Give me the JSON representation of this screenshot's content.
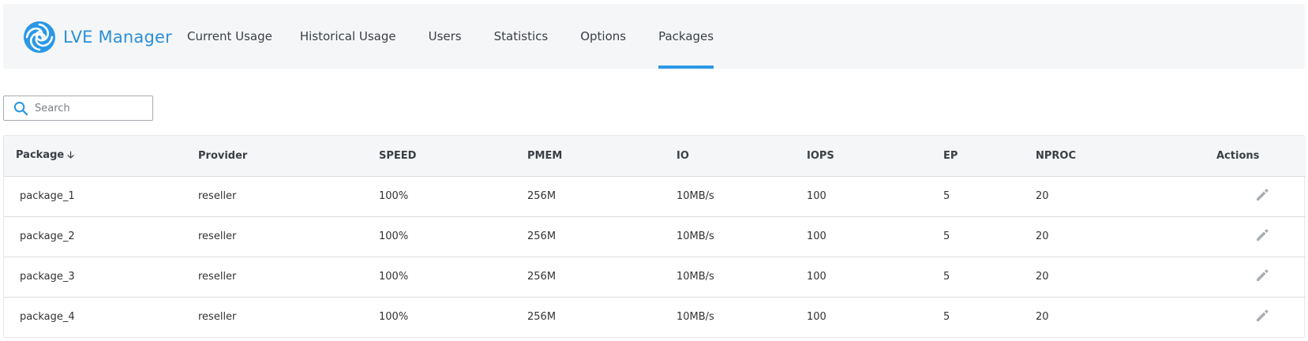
{
  "app": {
    "name": "LVE Manager",
    "accent": "#2a98e6"
  },
  "nav": [
    {
      "label": "Current Usage",
      "active": false
    },
    {
      "label": "Historical Usage",
      "active": false
    },
    {
      "label": "Users",
      "active": false
    },
    {
      "label": "Statistics",
      "active": false
    },
    {
      "label": "Options",
      "active": false
    },
    {
      "label": "Packages",
      "active": true
    }
  ],
  "search": {
    "placeholder": "Search",
    "value": "",
    "icon": "search-icon"
  },
  "table": {
    "columns": [
      "Package",
      "Provider",
      "SPEED",
      "PMEM",
      "IO",
      "IOPS",
      "EP",
      "NPROC",
      "Actions"
    ],
    "sort": {
      "column": "Package",
      "direction": "descending",
      "icon": "arrow-down-icon"
    },
    "rows": [
      {
        "package": "package_1",
        "provider": "reseller",
        "speed": "100%",
        "pmem": "256M",
        "io": "10MB/s",
        "iops": "100",
        "ep": "5",
        "nproc": "20"
      },
      {
        "package": "package_2",
        "provider": "reseller",
        "speed": "100%",
        "pmem": "256M",
        "io": "10MB/s",
        "iops": "100",
        "ep": "5",
        "nproc": "20"
      },
      {
        "package": "package_3",
        "provider": "reseller",
        "speed": "100%",
        "pmem": "256M",
        "io": "10MB/s",
        "iops": "100",
        "ep": "5",
        "nproc": "20"
      },
      {
        "package": "package_4",
        "provider": "reseller",
        "speed": "100%",
        "pmem": "256M",
        "io": "10MB/s",
        "iops": "100",
        "ep": "5",
        "nproc": "20"
      }
    ],
    "action_icon": "pencil-icon"
  }
}
